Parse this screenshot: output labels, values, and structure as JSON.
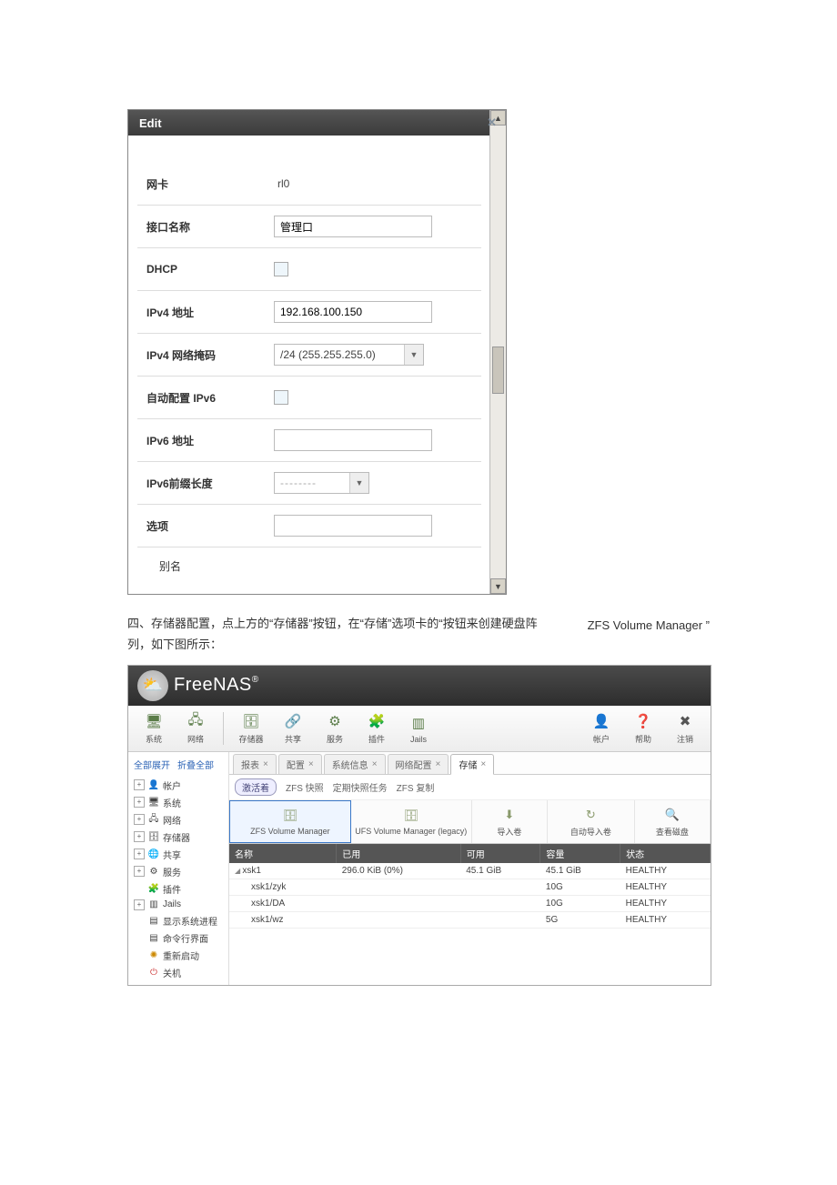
{
  "edit_dialog": {
    "title": "Edit",
    "rows": {
      "nic_label": "网卡",
      "nic_value": "rl0",
      "ifname_label": "接口名称",
      "ifname_value": "管理口",
      "dhcp_label": "DHCP",
      "ipv4addr_label": "IPv4 地址",
      "ipv4addr_value": "192.168.100.150",
      "ipv4mask_label": "IPv4 网络掩码",
      "ipv4mask_value": "/24 (255.255.255.0)",
      "autoipv6_label": "自动配置 IPv6",
      "ipv6addr_label": "IPv6 地址",
      "ipv6prefix_label": "IPv6前缀长度",
      "ipv6prefix_placeholder": "--------",
      "options_label": "选项",
      "alias_label": "别名"
    }
  },
  "body": {
    "para_left": "四、存储器配置，点上方的“存储器”按钮，在“存储”选项卡的“按钮来创建硬盘阵列，如下图所示：",
    "para_right": "ZFS Volume Manager ”"
  },
  "freenas": {
    "logo_text": "FreeNAS",
    "toolbar": {
      "system": "系统",
      "network": "网络",
      "storage": "存储器",
      "sharing": "共享",
      "services": "服务",
      "plugins": "插件",
      "jails": "Jails",
      "account": "帐户",
      "help": "帮助",
      "logout": "注销"
    },
    "sidebar": {
      "expand_all": "全部展开",
      "collapse_all": "折叠全部",
      "items": [
        "帐户",
        "系统",
        "网络",
        "存储器",
        "共享",
        "服务",
        "插件",
        "Jails",
        "显示系统进程",
        "命令行界面",
        "重新启动",
        "关机"
      ]
    },
    "tabs": [
      "报表",
      "配置",
      "系统信息",
      "网络配置",
      "存储"
    ],
    "subnav": {
      "active": "激活着",
      "items": [
        "ZFS 快照",
        "定期快照任务",
        "ZFS 复制"
      ]
    },
    "actions": {
      "zfsvm": "ZFS Volume Manager",
      "ufsvm": "UFS Volume Manager (legacy)",
      "import": "导入卷",
      "autoimport": "自动导入卷",
      "viewdisks": "查看磁盘"
    },
    "table": {
      "headers": [
        "名称",
        "已用",
        "可用",
        "容量",
        "状态"
      ],
      "rows": [
        {
          "name": "xsk1",
          "used": "296.0 KiB (0%)",
          "avail": "45.1 GiB",
          "cap": "45.1 GiB",
          "status": "HEALTHY",
          "top": true
        },
        {
          "name": "xsk1/zyk",
          "used": "",
          "avail": "",
          "cap": "10G",
          "status": "HEALTHY",
          "top": false
        },
        {
          "name": "xsk1/DA",
          "used": "",
          "avail": "",
          "cap": "10G",
          "status": "HEALTHY",
          "top": false
        },
        {
          "name": "xsk1/wz",
          "used": "",
          "avail": "",
          "cap": "5G",
          "status": "HEALTHY",
          "top": false
        }
      ]
    }
  }
}
